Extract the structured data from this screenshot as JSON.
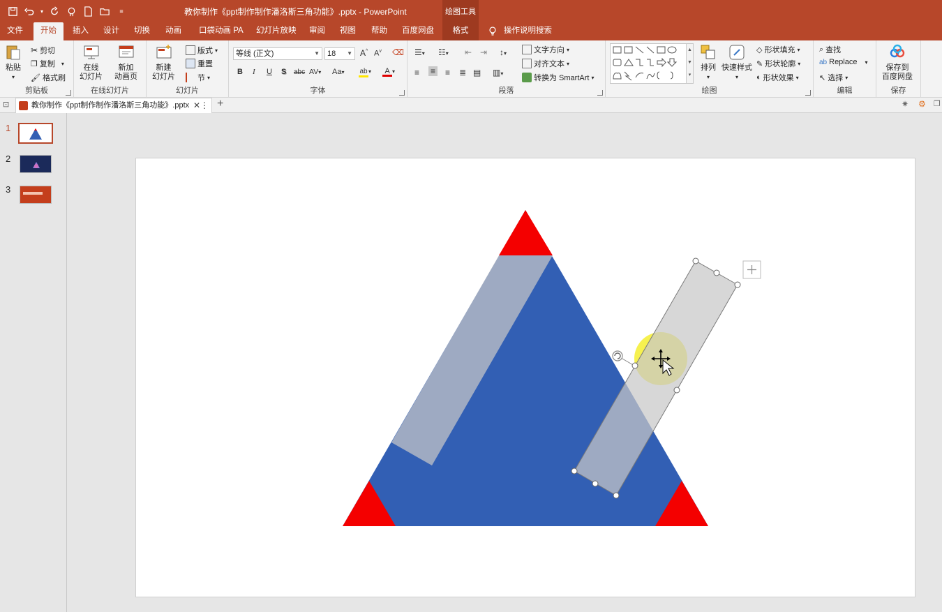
{
  "title_bar": {
    "document_title": "教你制作《ppt制作制作潘洛斯三角功能》.pptx  -  PowerPoint",
    "context_tools": "绘图工具",
    "colors": {
      "brand": "#b7472a",
      "context_tab": "#9e3a20"
    },
    "qat_icons": [
      "save-icon",
      "undo-icon",
      "redo-icon",
      "touch-mode-icon",
      "new-icon",
      "open-icon",
      "customize-icon"
    ]
  },
  "tabs": [
    "文件",
    "开始",
    "插入",
    "设计",
    "切换",
    "动画",
    "口袋动画 PA",
    "幻灯片放映",
    "审阅",
    "视图",
    "帮助",
    "百度网盘",
    "格式",
    "操作说明搜索"
  ],
  "active_tab": "开始",
  "ribbon": {
    "clipboard": {
      "label": "剪贴板",
      "paste": "粘贴",
      "cut": "剪切",
      "copy": "复制",
      "format_painter": "格式刷"
    },
    "online_slides": {
      "label": "在线幻灯片",
      "online_slide": "在线\n幻灯片",
      "new_anim_page": "新加\n动画页"
    },
    "slides": {
      "label": "幻灯片",
      "new_slide": "新建\n幻灯片",
      "layout": "版式",
      "reset": "重置",
      "section": "节"
    },
    "font": {
      "label": "字体",
      "font_name": "等线 (正文)",
      "font_size": "18",
      "bold": "B",
      "italic": "I",
      "underline": "U",
      "shadow": "S",
      "strike": "abc",
      "spacing": "AV",
      "case": "Aa"
    },
    "paragraph": {
      "label": "段落",
      "text_direction": "文字方向",
      "align_text": "对齐文本",
      "convert_smartart": "转换为 SmartArt"
    },
    "drawing": {
      "label": "绘图",
      "arrange": "排列",
      "quick_styles": "快速样式",
      "shape_fill": "形状填充",
      "shape_outline": "形状轮廓",
      "shape_effects": "形状效果"
    },
    "editing": {
      "label": "编辑",
      "find": "查找",
      "replace": "Replace",
      "select": "选择"
    },
    "save": {
      "label": "保存",
      "save_to": "保存到\n百度网盘"
    }
  },
  "doc_tab": {
    "title": "教你制作《ppt制作制作潘洛斯三角功能》.pptx"
  },
  "thumbnails": [
    "1",
    "2",
    "3"
  ],
  "selected_slide": "1",
  "slide_colors": {
    "triangle": "#325fb4",
    "corner": "#f40000",
    "strip": "#c8c8c8",
    "cursor_highlight": "#f5f03c"
  }
}
